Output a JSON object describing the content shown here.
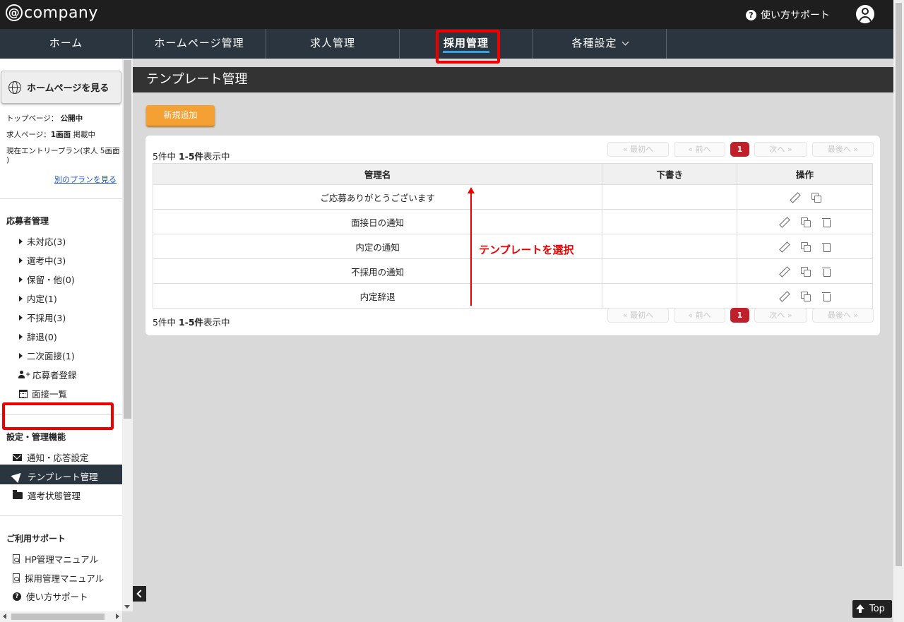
{
  "header": {
    "logo": "company",
    "logo_at": "@",
    "help_label": "使い方サポート"
  },
  "nav": {
    "items": [
      {
        "label": "ホーム"
      },
      {
        "label": "ホームページ管理"
      },
      {
        "label": "求人管理"
      },
      {
        "label": "採用管理"
      },
      {
        "label": "各種設定"
      }
    ]
  },
  "sidebar": {
    "hp_button": "ホームページを見る",
    "top_page_label": "トップページ：",
    "top_page_status": "公開中",
    "job_page_label": "求人ページ：",
    "job_page_count": "1画面",
    "job_page_status": "掲載中",
    "plan_text": "現在エントリープラン(求人 5画面",
    "plan_text_end": ")",
    "other_plan_link": "別のプランを見る",
    "applicants_heading": "応募者管理",
    "applicant_items": [
      {
        "label": "未対応(3)"
      },
      {
        "label": "選考中(3)"
      },
      {
        "label": "保留・他(0)"
      },
      {
        "label": "内定(1)"
      },
      {
        "label": "不採用(3)"
      },
      {
        "label": "辞退(0)"
      },
      {
        "label": "二次面接(1)"
      }
    ],
    "register_label": "応募者登録",
    "interviews_label": "面接一覧",
    "settings_heading": "設定・管理機能",
    "notify_label": "通知・応答設定",
    "template_label": "テンプレート管理",
    "status_label": "選考状態管理",
    "support_heading": "ご利用サポート",
    "hp_manual": "HP管理マニュアル",
    "recruit_manual": "採用管理マニュアル",
    "help_label": "使い方サポート"
  },
  "main": {
    "page_title": "テンプレート管理",
    "new_button": "新規追加",
    "count_prefix": "5件中 ",
    "count_range": "1-5件",
    "count_suffix": "表示中",
    "pager": {
      "first": "« 最初へ",
      "prev": "« 前へ",
      "current": "1",
      "next": "次へ »",
      "last": "最後へ »"
    },
    "table": {
      "headers": [
        "管理名",
        "下書き",
        "操作"
      ],
      "rows": [
        {
          "name": "ご応募ありがとうございます",
          "draft": ""
        },
        {
          "name": "面接日の通知",
          "draft": ""
        },
        {
          "name": "内定の通知",
          "draft": ""
        },
        {
          "name": "不採用の通知",
          "draft": ""
        },
        {
          "name": "内定辞退",
          "draft": ""
        }
      ]
    },
    "annotation": "テンプレートを選択",
    "top_button": "Top"
  },
  "colors": {
    "accent_orange": "#f5a032",
    "pager_active": "#c0202a",
    "nav_bg": "#2a3540",
    "annotation_red": "#ee0000"
  }
}
